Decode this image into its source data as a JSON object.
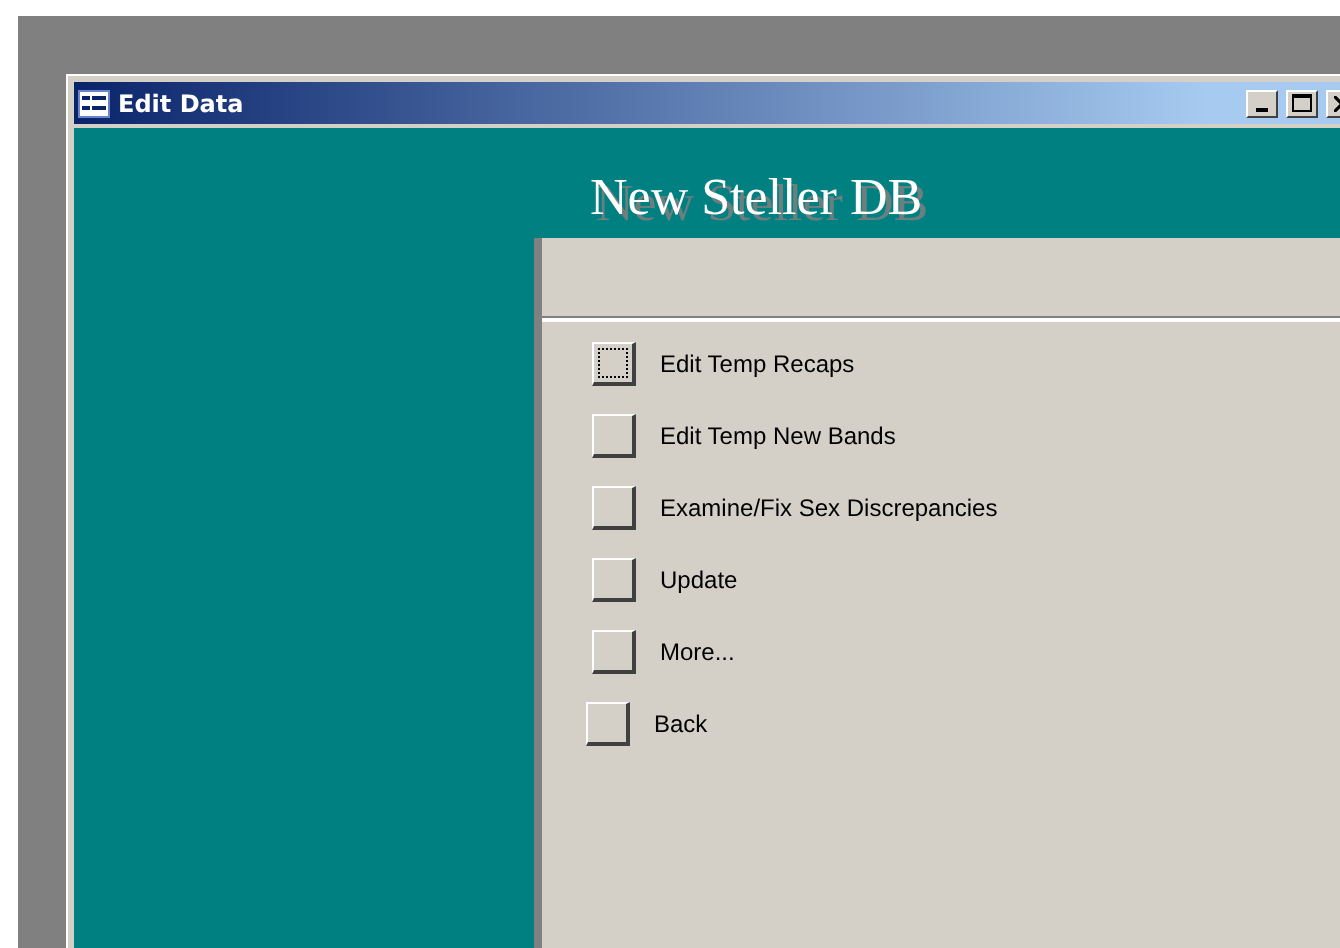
{
  "window": {
    "title": "Edit Data"
  },
  "form": {
    "heading": "New Steller DB"
  },
  "menu": [
    {
      "label": "Edit Temp Recaps",
      "focused": true,
      "kind": "option"
    },
    {
      "label": "Edit Temp New Bands",
      "focused": false,
      "kind": "option"
    },
    {
      "label": "Examine/Fix Sex Discrepancies",
      "focused": false,
      "kind": "option"
    },
    {
      "label": "Update",
      "focused": false,
      "kind": "option"
    },
    {
      "label": "More...",
      "focused": false,
      "kind": "option"
    },
    {
      "label": "Back",
      "focused": false,
      "kind": "back"
    }
  ]
}
